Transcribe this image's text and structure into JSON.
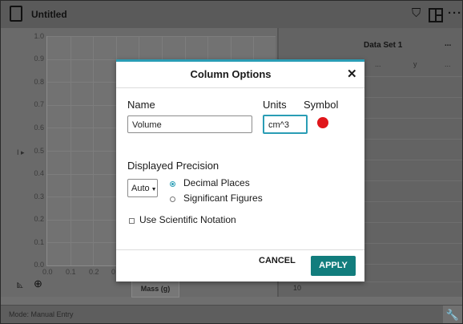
{
  "window": {
    "title": "Untitled"
  },
  "graph": {
    "y_ticks": [
      "1.0",
      "0.9",
      "0.8",
      "0.7",
      "0.6",
      "0.5",
      "0.4",
      "0.3",
      "0.2",
      "0.1",
      "0.0"
    ],
    "x_ticks": [
      "0.0",
      "0.1",
      "0.2",
      "0"
    ],
    "x_axis_label": "Mass (g)",
    "y_axis_button": "I ▸"
  },
  "table": {
    "dataset_title": "Data Set 1",
    "dataset_menu": "...",
    "col1_menu": "...",
    "col2_label": "y",
    "col2_menu": "...",
    "last_row_number": "10"
  },
  "status": {
    "mode": "Mode: Manual Entry"
  },
  "dialog": {
    "title": "Column Options",
    "close": "✕",
    "name_label": "Name",
    "name_value": "Volume",
    "units_label": "Units",
    "units_value": "cm^3",
    "symbol_label": "Symbol",
    "symbol_color": "#e0161b",
    "precision_label": "Displayed Precision",
    "precision_select": "Auto",
    "option_decimal": "Decimal Places",
    "option_significant": "Significant Figures",
    "selected_option": "Decimal Places",
    "scientific_label": "Use Scientific Notation",
    "cancel": "CANCEL",
    "apply": "APPLY"
  },
  "colors": {
    "accent": "#2a9db5",
    "apply_button": "#127d7d"
  },
  "icons": [
    "document-icon",
    "shield-icon",
    "layout-icon",
    "more-icon",
    "graph-tool-icon",
    "zoom-icon",
    "wrench-icon"
  ]
}
